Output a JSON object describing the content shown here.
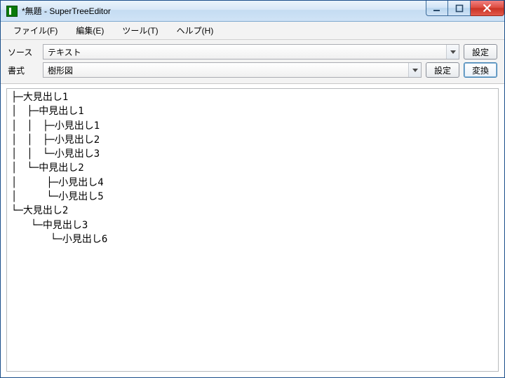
{
  "window": {
    "title": "*無題 - SuperTreeEditor"
  },
  "menu": {
    "file": "ファイル(F)",
    "edit": "編集(E)",
    "tool": "ツール(T)",
    "help": "ヘルプ(H)"
  },
  "controls": {
    "source_label": "ソース",
    "source_value": "テキスト",
    "source_setting_btn": "設定",
    "format_label": "書式",
    "format_value": "樹形図",
    "format_setting_btn": "設定",
    "convert_btn": "変換"
  },
  "output_text": "├─大見出し1\n│　├─中見出し1\n│　│　├─小見出し1\n│　│　├─小見出し2\n│　│　└─小見出し3\n│　└─中見出し2\n│　　　├─小見出し4\n│　　　└─小見出し5\n└─大見出し2\n　　└─中見出し3\n　　　　└─小見出し6"
}
